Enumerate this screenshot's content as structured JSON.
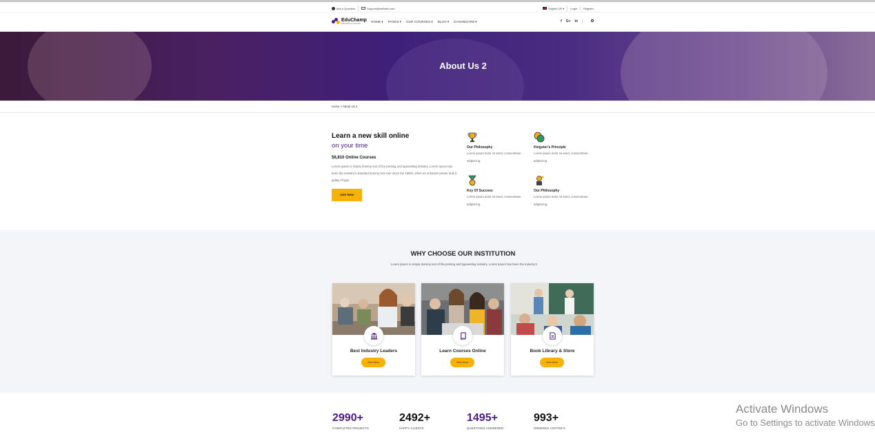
{
  "topbar": {
    "ask_question": "Ask a Question",
    "email": "Support@website.com",
    "language": "English UK",
    "login": "Login",
    "register": "Register"
  },
  "logo": {
    "name": "EduChamp",
    "tagline": "Education & Courses"
  },
  "nav": {
    "items": [
      {
        "label": "HOME",
        "icon": "chevron-down-icon"
      },
      {
        "label": "PAGES",
        "icon": "chevron-down-icon"
      },
      {
        "label": "OUR COURSES",
        "icon": "chevron-down-icon"
      },
      {
        "label": "BLOG",
        "icon": "chevron-down-icon"
      },
      {
        "label": "DASHBOARD",
        "icon": "chevron-down-icon"
      }
    ],
    "social": [
      "f",
      "G+",
      "in"
    ],
    "search_icon": "search-icon"
  },
  "banner": {
    "title": "About Us 2"
  },
  "breadcrumb": {
    "home": "Home",
    "separator": ">",
    "current": "About Us 2"
  },
  "about": {
    "heading": "Learn a new skill online",
    "subheading": "on your time",
    "count": "56,810 Online Courses",
    "text": "Lorem Ipsum is simply dummy text of the printing and typesetting industry. Lorem Ipsum has been the industry's standard dummy text ever since the 1500s, when an unknown printer took a galley of type.",
    "button": "Join Now",
    "features": [
      {
        "title": "Our Philosophy",
        "desc": "Lorem ipsum dolor sit amet, consectetuer adipiscing.",
        "icon": "trophy-icon"
      },
      {
        "title": "Kingster's Principle",
        "desc": "Lorem ipsum dolor sit amet, consectetuer adipiscing.",
        "icon": "chat-bubbles-icon"
      },
      {
        "title": "Key Of Success",
        "desc": "Lorem ipsum dolor sit amet, consectetuer adipiscing.",
        "icon": "medal-icon"
      },
      {
        "title": "Our Philosophy",
        "desc": "Lorem ipsum dolor sit amet, consectetuer adipiscing.",
        "icon": "thinker-icon"
      }
    ]
  },
  "why": {
    "title_bold": "WHY CHOOSE",
    "title_rest": "OUR INSTITUTION",
    "subtitle": "Lorem Ipsum is simply dummy text of the printing and typesetting industry. Lorem Ipsum has been the industry's",
    "cards": [
      {
        "title": "Best Industry Leaders",
        "button": "View More",
        "icon": "institution-icon"
      },
      {
        "title": "Learn Courses Online",
        "button": "View More",
        "icon": "book-icon"
      },
      {
        "title": "Book Library & Store",
        "button": "View More",
        "icon": "document-icon"
      }
    ]
  },
  "stats": [
    {
      "value": "2990+",
      "label": "COMPLETED PROJECTS"
    },
    {
      "value": "2492+",
      "label": "HAPPY CLIENTS"
    },
    {
      "value": "1495+",
      "label": "QUESTIONS ANSWERED"
    },
    {
      "value": "993+",
      "label": "ORDERED COFFEE'S"
    }
  ],
  "watermark": {
    "line1": "Activate Windows",
    "line2": "Go to Settings to activate Windows."
  },
  "colors": {
    "brand_purple": "#4c1a87",
    "accent_yellow": "#f7b205",
    "section_bg": "#f4f5f8"
  }
}
